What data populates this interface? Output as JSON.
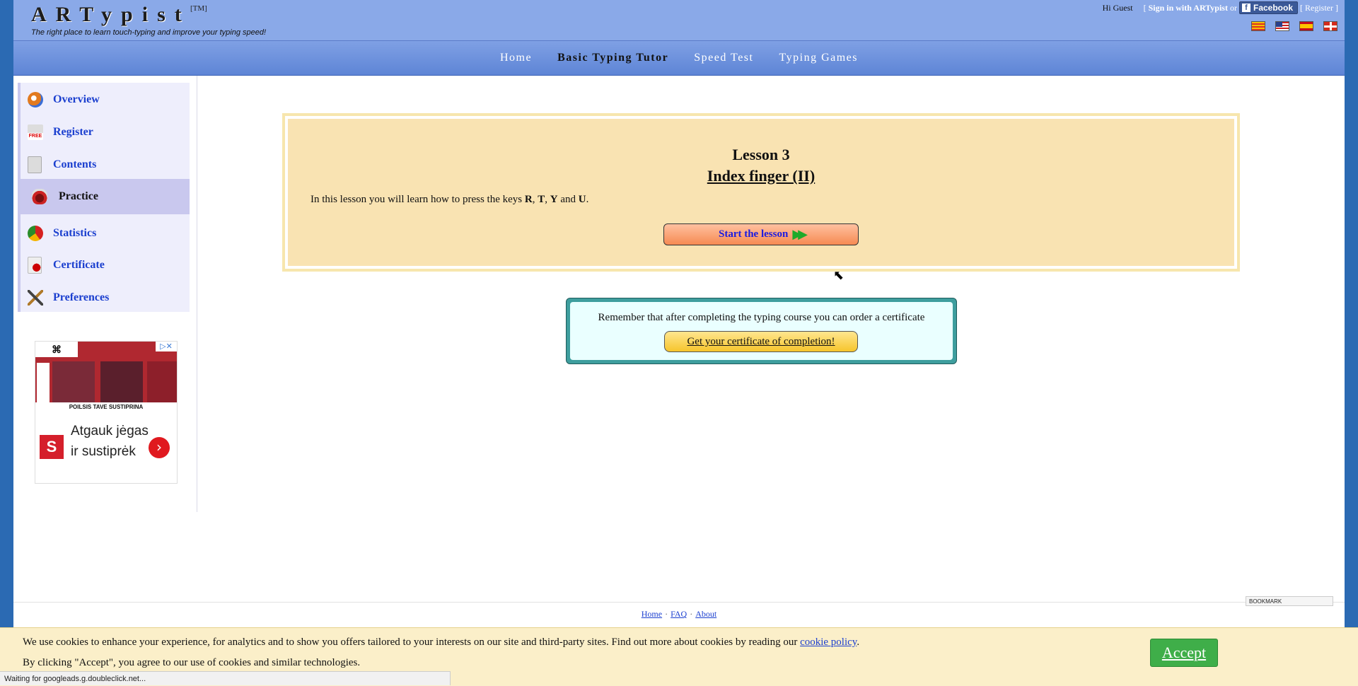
{
  "header": {
    "logo": "ARTypist",
    "trademark": "[TM]",
    "tagline": "The right place to learn touch-typing and improve your typing speed!",
    "greeting": "Hi",
    "user": "Guest",
    "bracket_open": "[",
    "signin": "Sign in with ARTypist",
    "or": "or",
    "facebook": "Facebook",
    "register": "Register",
    "bracket_close": "]"
  },
  "nav": {
    "items": [
      "Home",
      "Basic Typing Tutor",
      "Speed Test",
      "Typing Games"
    ],
    "active": "Basic Typing Tutor"
  },
  "sidebar": {
    "items": [
      {
        "label": "Overview",
        "icon": "overview-icon"
      },
      {
        "label": "Register",
        "icon": "free-register-icon"
      },
      {
        "label": "Contents",
        "icon": "contents-icon"
      },
      {
        "label": "Practice",
        "icon": "practice-icon"
      },
      {
        "label": "Statistics",
        "icon": "statistics-icon"
      },
      {
        "label": "Certificate",
        "icon": "certificate-icon"
      },
      {
        "label": "Preferences",
        "icon": "preferences-icon"
      }
    ],
    "active": "Practice"
  },
  "ad": {
    "tagline": "POILSIS TAVE SUSTIPRINA",
    "text": "Atgauk jėgas ir sustiprėk",
    "close": "▷✕"
  },
  "lesson": {
    "number": "Lesson 3",
    "title": "Index finger (II)",
    "desc_prefix": "In this lesson you will learn how to press the keys ",
    "keys": [
      "R",
      "T",
      "Y",
      "U"
    ],
    "sep1": ", ",
    "sep2": ", ",
    "sep3": " and ",
    "suffix": ".",
    "start_label": "Start the lesson"
  },
  "certificate": {
    "text": "Remember that after completing the typing course you can order a certificate",
    "button": "Get your certificate of completion!"
  },
  "footer": {
    "links": [
      "Home",
      "FAQ",
      "About"
    ],
    "bookmark": "BOOKMARK"
  },
  "cookie": {
    "line1_prefix": "We use cookies to enhance your experience, for analytics and to show you offers tailored to your interests on our site and third-party sites. Find out more about cookies by reading our ",
    "policy_link": "cookie policy",
    "line1_suffix": ".",
    "line2": "By clicking \"Accept\", you agree to our use of cookies and similar technologies.",
    "accept": "Accept"
  },
  "status": "Waiting for googleads.g.doubleclick.net...",
  "colors": {
    "header_bg": "#8aa9e8",
    "link": "#1b3fcf",
    "lesson_bg": "#f9e3b2",
    "accept_green": "#3fae49"
  }
}
